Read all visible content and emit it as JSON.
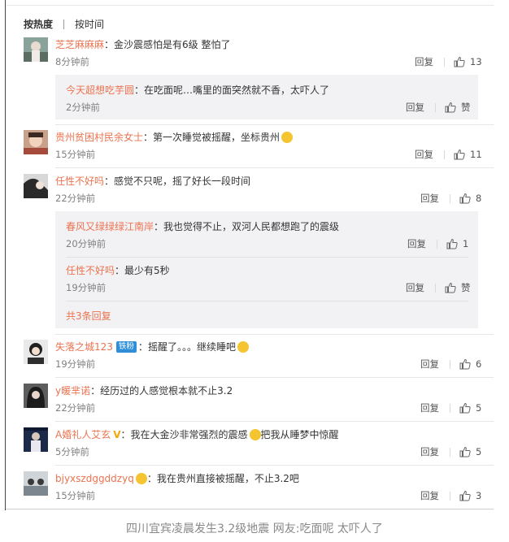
{
  "sort": {
    "hot": "按热度",
    "time": "按时间"
  },
  "actions": {
    "reply": "回复",
    "like": "赞"
  },
  "comments": [
    {
      "user": "芝芝麻麻麻",
      "text": "金沙震感怕是有6级 整怕了",
      "time": "8分钟前",
      "likes": "13"
    },
    {
      "user": "今天超想吃芋圆",
      "text": "在吃面呢…嘴里的面突然就不香，太吓人了",
      "time": "2分钟前",
      "likes": "赞"
    },
    {
      "user": "贵州贫困村民余女士",
      "text": "第一次睡觉被摇醒，坐标贵州",
      "time": "15分钟前",
      "likes": "11"
    },
    {
      "user": "任性不好吗",
      "text": "感觉不只呢，摇了好长一段时间",
      "time": "22分钟前",
      "likes": "8"
    },
    {
      "user": "春风又绿绿绿江南岸",
      "text": "我也觉得不止，双河人民都想跑了的震级",
      "time": "20分钟前",
      "likes": "1"
    },
    {
      "user": "任性不好吗",
      "text": "最少有5秒",
      "time": "19分钟前",
      "likes": "赞"
    },
    {
      "user": "失落之城123",
      "badge": "铁粉",
      "text": "摇醒了。。。继续睡吧",
      "time": "19分钟前",
      "likes": "6"
    },
    {
      "user": "y暖芈诺",
      "text": "经历过的人感觉根本就不止3.2",
      "time": "22分钟前",
      "likes": "5"
    },
    {
      "user": "A婚礼人艾玄",
      "text_a": "我在大金沙非常强烈的震感",
      "text_b": "把我从睡梦中惊醒",
      "time": "5分钟前",
      "likes": "5"
    },
    {
      "user": "bjyxszdggddzyq",
      "text": "我在贵州直接被摇醒，不止3.2吧",
      "time": "15分钟前",
      "likes": "3"
    }
  ],
  "more_replies": "共3条回复",
  "caption": "四川宜宾凌晨发生3.2级地震 网友:吃面呢 太吓人了",
  "colors": {
    "username": "#eb7350",
    "badge": "#2e8fd8",
    "subbg": "#f2f2f5"
  }
}
